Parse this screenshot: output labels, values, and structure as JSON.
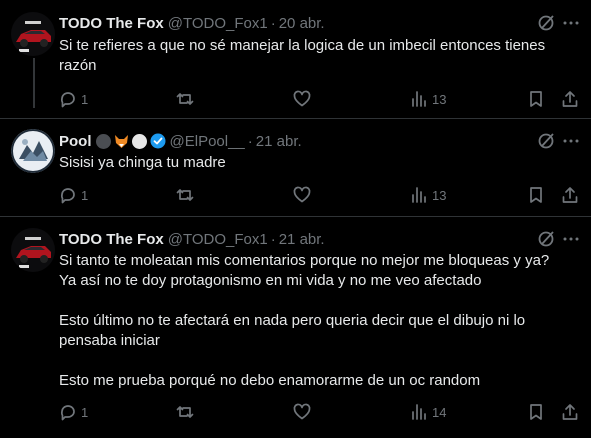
{
  "tweets": [
    {
      "name": "TODO The Fox",
      "handle": "@TODO_Fox1",
      "dot": "·",
      "date": "20 abr.",
      "lines": [
        "Si te refieres a que no sé manejar la logica de un imbecil entonces tienes",
        "razón"
      ],
      "replies": "1",
      "retweets": "",
      "likes": "",
      "views": "13"
    },
    {
      "name": "Pool",
      "handle": "@ElPool__",
      "dot": "·",
      "date": "21 abr.",
      "lines": [
        "Sisisi ya chinga tu madre"
      ],
      "replies": "1",
      "retweets": "",
      "likes": "",
      "views": "13"
    },
    {
      "name": "TODO The Fox",
      "handle": "@TODO_Fox1",
      "dot": "·",
      "date": "21 abr.",
      "lines": [
        "Si tanto te moleatan mis comentarios porque no mejor me bloqueas y ya?",
        "Ya así no te doy protagonismo en mi vida y no me veo afectado",
        "",
        "Esto último no te afectará en nada pero queria decir que el dibujo ni lo",
        "pensaba iniciar",
        "",
        "Esto me prueba porqué no debo enamorarme de un oc random"
      ],
      "replies": "1",
      "retweets": "",
      "likes": "",
      "views": "14"
    }
  ],
  "icons": {
    "reply": "reply-icon",
    "retweet": "retweet-icon",
    "like": "heart-icon",
    "views": "views-icon",
    "bookmark": "bookmark-icon",
    "share": "share-icon",
    "grok": "grok-icon",
    "more": "more-icon"
  },
  "colors": {
    "background": "#000000",
    "text": "#e7e9ea",
    "secondary": "#71767b",
    "divider": "#2f3336",
    "verified": "#1d9bf0"
  }
}
